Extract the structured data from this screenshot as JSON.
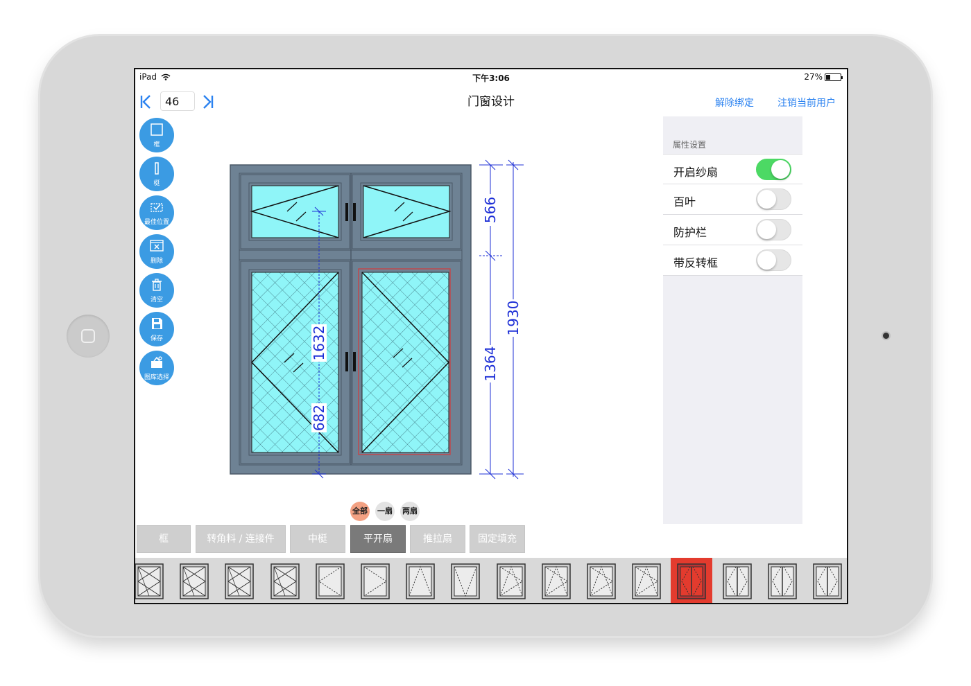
{
  "status_bar": {
    "device": "iPad",
    "time": "下午3:06",
    "battery": "27%",
    "battery_level": 0.27
  },
  "nav": {
    "first_icon": "first-page-icon",
    "last_icon": "last-page-icon",
    "page_value": "46",
    "title": "门窗设计",
    "unbind_label": "解除绑定",
    "logout_label": "注销当前用户",
    "accent_color": "#2b82f0"
  },
  "toolbar": {
    "items": [
      {
        "label": "框",
        "icon": "frame-icon"
      },
      {
        "label": "梃",
        "icon": "mullion-icon"
      },
      {
        "label": "最佳位置",
        "icon": "best-position-icon"
      },
      {
        "label": "删除",
        "icon": "delete-icon"
      },
      {
        "label": "清空",
        "icon": "trash-icon"
      },
      {
        "label": "保存",
        "icon": "save-icon"
      },
      {
        "label": "图库选择",
        "icon": "gallery-icon"
      }
    ],
    "button_color": "#3b9be3"
  },
  "drawing": {
    "frame_color": "#6e8294",
    "glass_color": "#8ff5f8",
    "dimension_color": "#1d2fd6",
    "dimensions": {
      "top_height": "566",
      "bottom_height": "1364",
      "total_height": "1930",
      "mullion_height": "1632",
      "handle_height": "682"
    }
  },
  "properties": {
    "header": "属性设置",
    "rows": [
      {
        "label": "开启纱扇",
        "on": true
      },
      {
        "label": "百叶",
        "on": false
      },
      {
        "label": "防护栏",
        "on": false
      },
      {
        "label": "带反转框",
        "on": false
      }
    ],
    "switch_on_color": "#4cd964"
  },
  "filters": {
    "items": [
      {
        "label": "全部",
        "active": true
      },
      {
        "label": "一扇",
        "active": false
      },
      {
        "label": "两扇",
        "active": false
      }
    ]
  },
  "categories": {
    "items": [
      {
        "label": "框",
        "active": false
      },
      {
        "label": "转角料 / 连接件",
        "active": false
      },
      {
        "label": "中梃",
        "active": false
      },
      {
        "label": "平开扇",
        "active": true
      },
      {
        "label": "推拉扇",
        "active": false
      },
      {
        "label": "固定填充",
        "active": false
      }
    ]
  },
  "thumbnails": {
    "selected_index": 12,
    "selected_color": "#e33b2e",
    "items": [
      {
        "icon": "casement-x-thumbnail-icon"
      },
      {
        "icon": "casement-x-thumbnail-icon"
      },
      {
        "icon": "casement-x-thumbnail-icon"
      },
      {
        "icon": "casement-x-thumbnail-icon"
      },
      {
        "icon": "casement-left-open-thumbnail-icon"
      },
      {
        "icon": "casement-right-open-thumbnail-icon"
      },
      {
        "icon": "casement-top-open-thumbnail-icon"
      },
      {
        "icon": "casement-bottom-open-thumbnail-icon"
      },
      {
        "icon": "tilt-turn-thumbnail-icon"
      },
      {
        "icon": "tilt-turn-thumbnail-icon"
      },
      {
        "icon": "tilt-turn-thumbnail-icon"
      },
      {
        "icon": "tilt-turn-thumbnail-icon"
      },
      {
        "icon": "double-casement-thumbnail-icon"
      },
      {
        "icon": "double-casement-thumbnail-icon"
      },
      {
        "icon": "double-casement-thumbnail-icon"
      },
      {
        "icon": "double-casement-thumbnail-icon"
      }
    ]
  }
}
